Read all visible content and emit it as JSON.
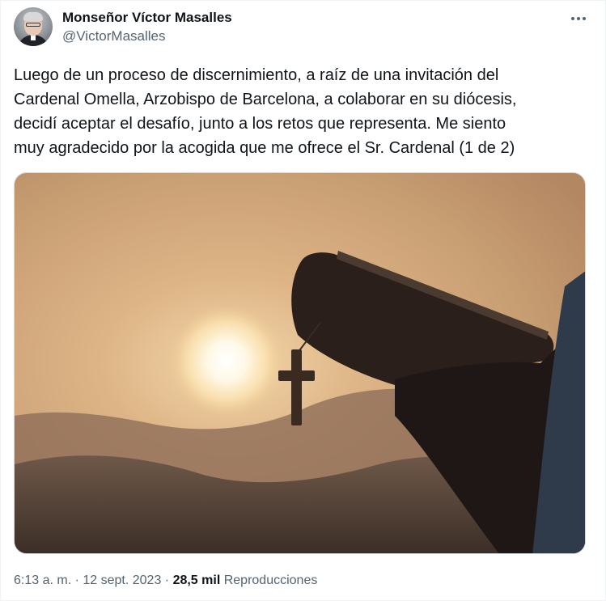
{
  "author": {
    "display_name": "Monseñor Víctor Masalles",
    "handle": "@VictorMasalles"
  },
  "tweet": {
    "lines": [
      "Luego de un proceso de discernimiento, a raíz de una invitación del",
      "Cardenal Omella, Arzobispo de Barcelona, a colaborar en su diócesis,",
      "decidí aceptar el desafío, junto a los retos que representa. Me siento",
      "muy agradecido por la acogida que me ofrece el Sr. Cardenal (1 de 2)"
    ]
  },
  "meta": {
    "time": "6:13 a. m.",
    "sep1": " · ",
    "date": "12 sept. 2023",
    "sep2": " · ",
    "views_count": "28,5 mil",
    "views_label": " Reproducciones"
  },
  "icons": {
    "more": "more-horizontal-icon"
  },
  "colors": {
    "text_primary": "#0f1419",
    "text_secondary": "#536471",
    "border": "#cfd9de"
  }
}
